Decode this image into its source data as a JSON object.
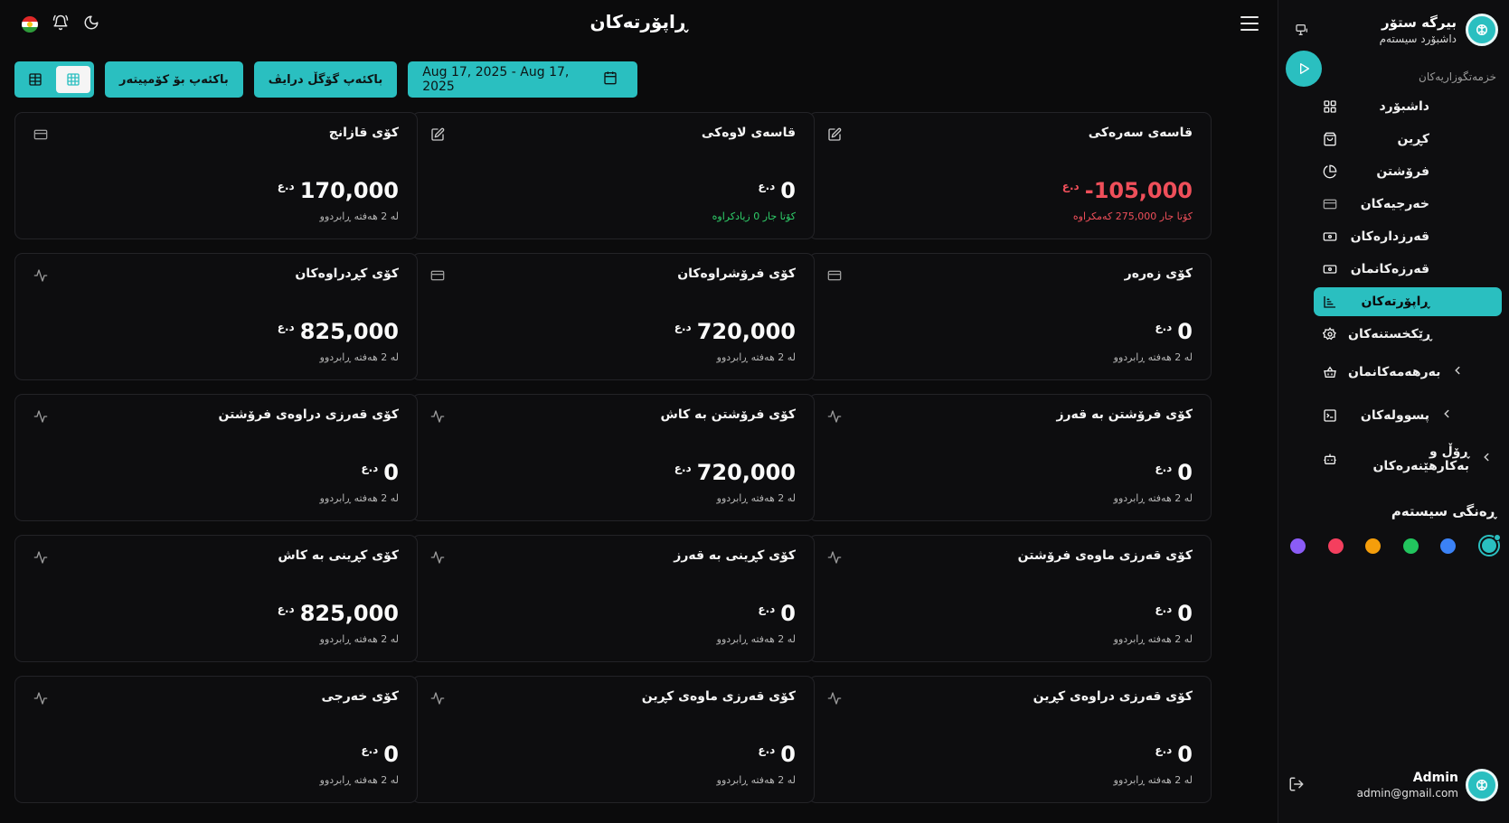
{
  "colors": {
    "accent": "#2abfc0",
    "negative": "#ef4f5a",
    "positive": "#2fcf6a"
  },
  "brand": {
    "name": "بیرگە ستۆر",
    "subtitle": "داشبۆرد سیستەم"
  },
  "sidebar": {
    "section_label": "خزمەتگوزاریەکان",
    "items": [
      {
        "label": "داشبۆرد",
        "icon": "dashboard-icon"
      },
      {
        "label": "کڕین",
        "icon": "shopping-bag-icon"
      },
      {
        "label": "فرۆشتن",
        "icon": "pie-chart-icon"
      },
      {
        "label": "خەرجیەکان",
        "icon": "credit-card-icon"
      },
      {
        "label": "قەرزدارەکان",
        "icon": "banknote-icon"
      },
      {
        "label": "قەرزەکانمان",
        "icon": "banknote-icon"
      },
      {
        "label": "ڕاپۆرتەکان",
        "icon": "report-chart-icon",
        "active": true
      },
      {
        "label": "ڕێکخستنەکان",
        "icon": "settings-gear-icon"
      }
    ],
    "groups": [
      {
        "label": "بەرهەمەکانمان",
        "icon": "basket-icon"
      },
      {
        "label": "پسوولەکان",
        "icon": "receipt-icon"
      },
      {
        "label": "ڕۆڵ و بەکارهێنەرەکان",
        "icon": "robot-icon"
      }
    ],
    "theme_title": "ڕەنگی سیستەم",
    "theme_colors": [
      "#2abfc0",
      "#3b82f6",
      "#22c55e",
      "#f59e0b",
      "#f43f5e",
      "#8b5cf6"
    ]
  },
  "user": {
    "name": "Admin",
    "email": "admin@gmail.com"
  },
  "header": {
    "title": "ڕاپۆرتەکان"
  },
  "toolbar": {
    "date_range": "Aug 17, 2025 - Aug 17, 2025",
    "backup_drive": "باکئەپ گۆگڵ درایڤ",
    "backup_computer": "باکئەپ بۆ کۆمپیتەر"
  },
  "currency": "د.ع",
  "cards": [
    {
      "title": "قاسەی سەرەکی",
      "value": "105,000-",
      "sub": "کۆتا جار 275,000 کەمکراوە",
      "icon": "edit-icon",
      "value_style": "neg",
      "sub_style": "red"
    },
    {
      "title": "قاسەی لاوەکی",
      "value": "0",
      "sub": "کۆتا جار 0 زیادکراوە",
      "icon": "edit-icon",
      "value_style": "",
      "sub_style": "green"
    },
    {
      "title": "کۆی قازانج",
      "value": "170,000",
      "sub": "لە 2 هەفتە ڕابردوو",
      "icon": "credit-card-icon",
      "value_style": "",
      "sub_style": ""
    },
    {
      "title": "کۆی زەرەر",
      "value": "0",
      "sub": "لە 2 هەفتە ڕابردوو",
      "icon": "credit-card-icon",
      "value_style": "",
      "sub_style": ""
    },
    {
      "title": "کۆی فرۆشراوەکان",
      "value": "720,000",
      "sub": "لە 2 هەفتە ڕابردوو",
      "icon": "credit-card-icon",
      "value_style": "",
      "sub_style": ""
    },
    {
      "title": "کۆی کڕدراوەکان",
      "value": "825,000",
      "sub": "لە 2 هەفتە ڕابردوو",
      "icon": "activity-icon",
      "value_style": "",
      "sub_style": ""
    },
    {
      "title": "کۆی فرۆشتن بە قەرز",
      "value": "0",
      "sub": "لە 2 هەفتە ڕابردوو",
      "icon": "activity-icon",
      "value_style": "",
      "sub_style": ""
    },
    {
      "title": "کۆی فرۆشتن بە کاش",
      "value": "720,000",
      "sub": "لە 2 هەفتە ڕابردوو",
      "icon": "activity-icon",
      "value_style": "",
      "sub_style": ""
    },
    {
      "title": "کۆی قەرزی دراوەی فرۆشتن",
      "value": "0",
      "sub": "لە 2 هەفتە ڕابردوو",
      "icon": "activity-icon",
      "value_style": "",
      "sub_style": ""
    },
    {
      "title": "کۆی قەرزی ماوەی فرۆشتن",
      "value": "0",
      "sub": "لە 2 هەفتە ڕابردوو",
      "icon": "activity-icon",
      "value_style": "",
      "sub_style": ""
    },
    {
      "title": "کۆی کڕینی بە قەرز",
      "value": "0",
      "sub": "لە 2 هەفتە ڕابردوو",
      "icon": "activity-icon",
      "value_style": "",
      "sub_style": ""
    },
    {
      "title": "کۆی کڕینی بە کاش",
      "value": "825,000",
      "sub": "لە 2 هەفتە ڕابردوو",
      "icon": "activity-icon",
      "value_style": "",
      "sub_style": ""
    },
    {
      "title": "کۆی قەرزی دراوەی کڕین",
      "value": "0",
      "sub": "لە 2 هەفتە ڕابردوو",
      "icon": "activity-icon",
      "value_style": "",
      "sub_style": ""
    },
    {
      "title": "کۆی قەرزی ماوەی کڕین",
      "value": "0",
      "sub": "لە 2 هەفتە ڕابردوو",
      "icon": "activity-icon",
      "value_style": "",
      "sub_style": ""
    },
    {
      "title": "کۆی خەرجی",
      "value": "0",
      "sub": "لە 2 هەفتە ڕابردوو",
      "icon": "activity-icon",
      "value_style": "",
      "sub_style": ""
    }
  ]
}
